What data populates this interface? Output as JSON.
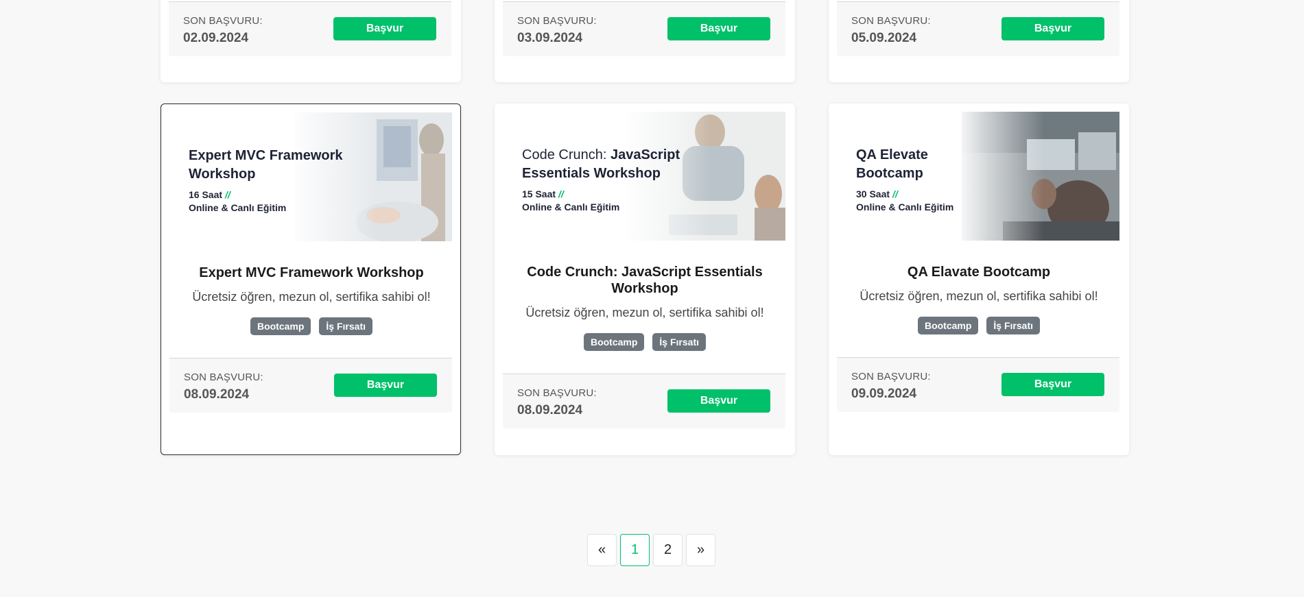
{
  "top_row": [
    {
      "deadline_label": "SON BAŞVURU:",
      "deadline_date": "02.09.2024",
      "apply_label": "Başvur"
    },
    {
      "deadline_label": "SON BAŞVURU:",
      "deadline_date": "03.09.2024",
      "apply_label": "Başvur"
    },
    {
      "deadline_label": "SON BAŞVURU:",
      "deadline_date": "05.09.2024",
      "apply_label": "Başvur"
    }
  ],
  "cards": [
    {
      "banner": {
        "title_light": "",
        "title_bold": "Expert MVC Framework Workshop",
        "hours": "16 Saat",
        "slash": "//",
        "mode": "Online & Canlı Eğitim"
      },
      "title": "Expert MVC Framework Workshop",
      "description": "Ücretsiz öğren, mezun ol, sertifika sahibi ol!",
      "tags": [
        "Bootcamp",
        "İş Fırsatı"
      ],
      "deadline_label": "SON BAŞVURU:",
      "deadline_date": "08.09.2024",
      "apply_label": "Başvur"
    },
    {
      "banner": {
        "title_light": "Code Crunch: ",
        "title_bold": "JavaScript Essentials Workshop",
        "hours": "15 Saat",
        "slash": "//",
        "mode": "Online & Canlı Eğitim"
      },
      "title": "Code Crunch: JavaScript Essentials Workshop",
      "description": "Ücretsiz öğren, mezun ol, sertifika sahibi ol!",
      "tags": [
        "Bootcamp",
        "İş Fırsatı"
      ],
      "deadline_label": "SON BAŞVURU:",
      "deadline_date": "08.09.2024",
      "apply_label": "Başvur"
    },
    {
      "banner": {
        "title_light": "",
        "title_bold": "QA Elevate Bootcamp",
        "hours": "30 Saat",
        "slash": "//",
        "mode": "Online & Canlı Eğitim"
      },
      "title": "QA Elavate Bootcamp",
      "description": "Ücretsiz öğren, mezun ol, sertifika sahibi ol!",
      "tags": [
        "Bootcamp",
        "İş Fırsatı"
      ],
      "deadline_label": "SON BAŞVURU:",
      "deadline_date": "09.09.2024",
      "apply_label": "Başvur"
    }
  ],
  "pagination": {
    "prev": "«",
    "pages": [
      "1",
      "2"
    ],
    "next": "»",
    "current": "1"
  },
  "colors": {
    "accent": "#00c06a",
    "tag": "#6c757d",
    "background": "#f8f8f8"
  }
}
